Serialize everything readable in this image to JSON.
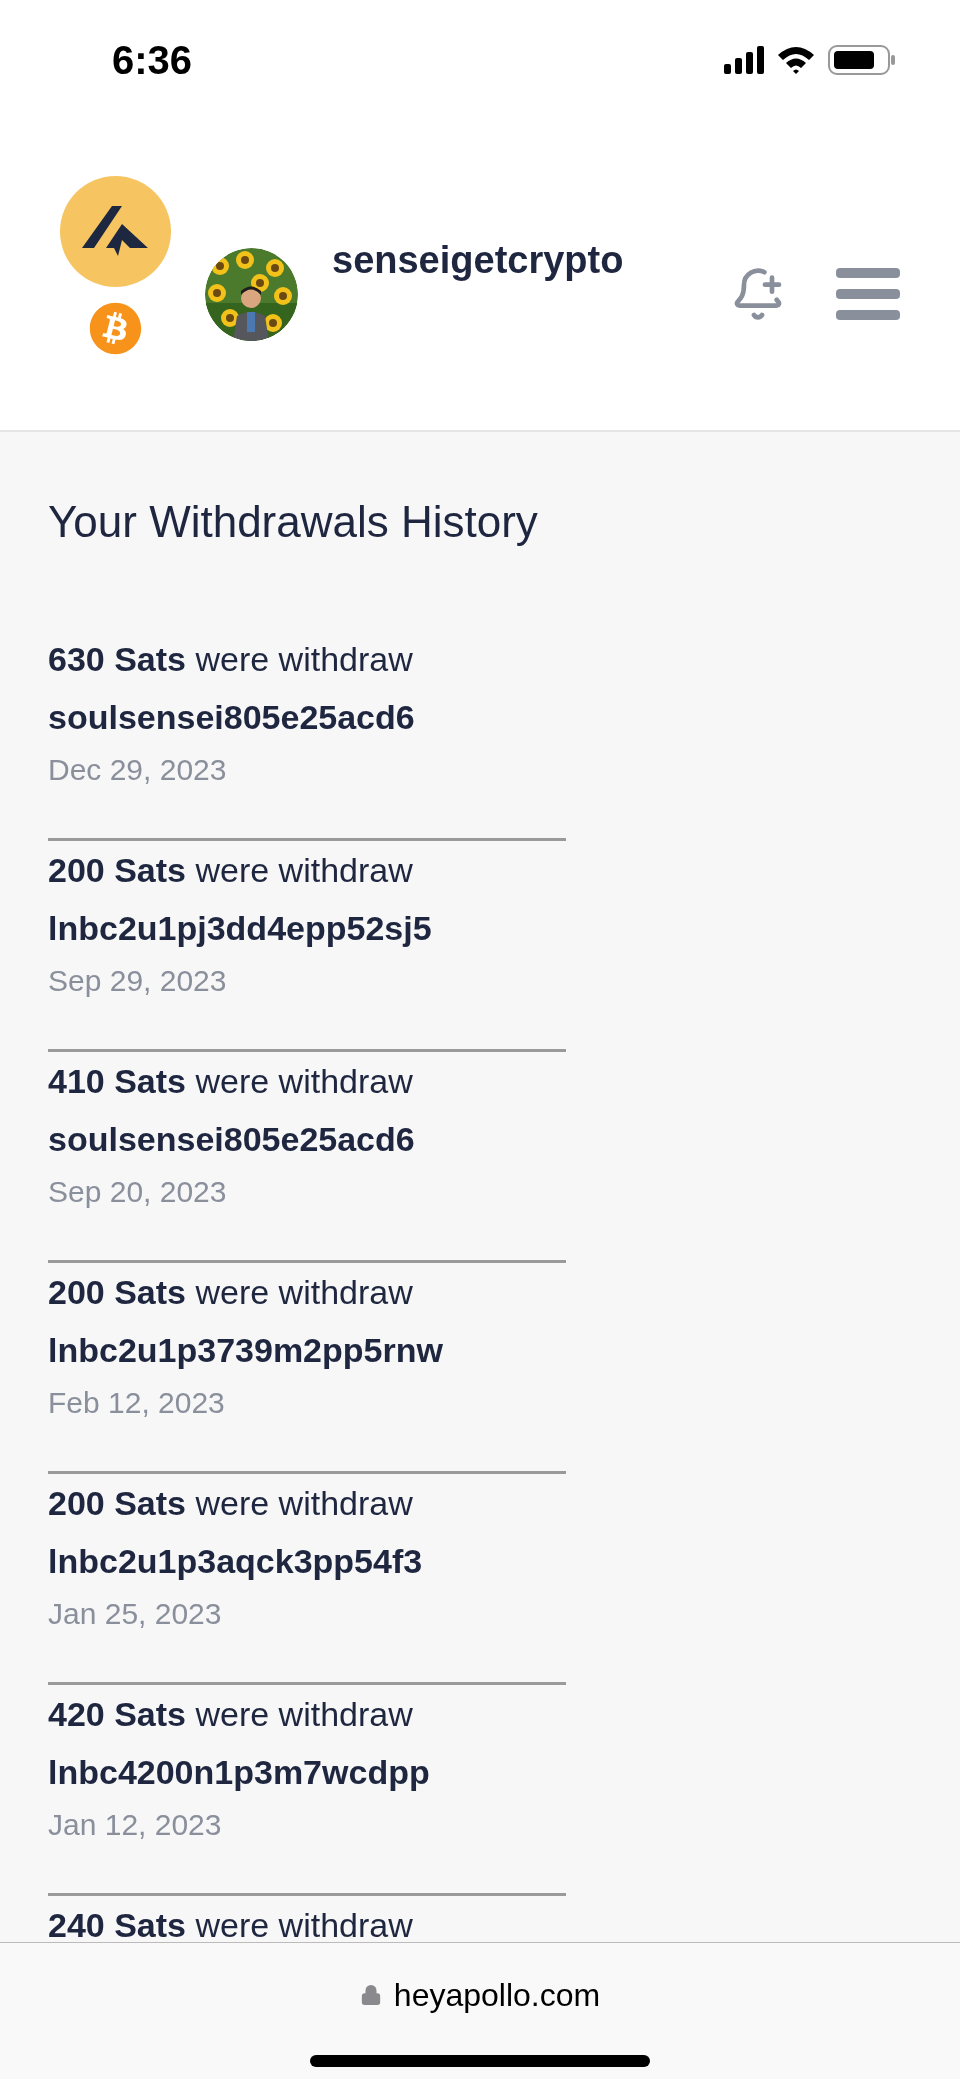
{
  "status_bar": {
    "time": "6:36"
  },
  "header": {
    "username": "senseigetcrypto"
  },
  "title": "Your Withdrawals History",
  "withdrawals": [
    {
      "summary": "**630 Sats** were withdraw",
      "destination": "soulsensei805e25acd6",
      "date": "Dec 29, 2023"
    },
    {
      "summary": "**200 Sats** were withdraw",
      "destination": "lnbc2u1pj3dd4epp52sj5",
      "date": "Sep 29, 2023"
    },
    {
      "summary": "**410 Sats** were withdraw",
      "destination": "soulsensei805e25acd6",
      "date": "Sep 20, 2023"
    },
    {
      "summary": "**200 Sats** were withdraw",
      "destination": "lnbc2u1p3739m2pp5rnw",
      "date": "Feb 12, 2023"
    },
    {
      "summary": "**200 Sats** were withdraw",
      "destination": "lnbc2u1p3aqck3pp54f3",
      "date": "Jan 25, 2023"
    },
    {
      "summary": "**420 Sats** were withdraw",
      "destination": "lnbc4200n1p3m7wcdpp",
      "date": "Jan 12, 2023"
    },
    {
      "summary": "**240 Sats** were withdraw"
    }
  ],
  "browser_bar": {
    "url": "heyapollo.com"
  }
}
